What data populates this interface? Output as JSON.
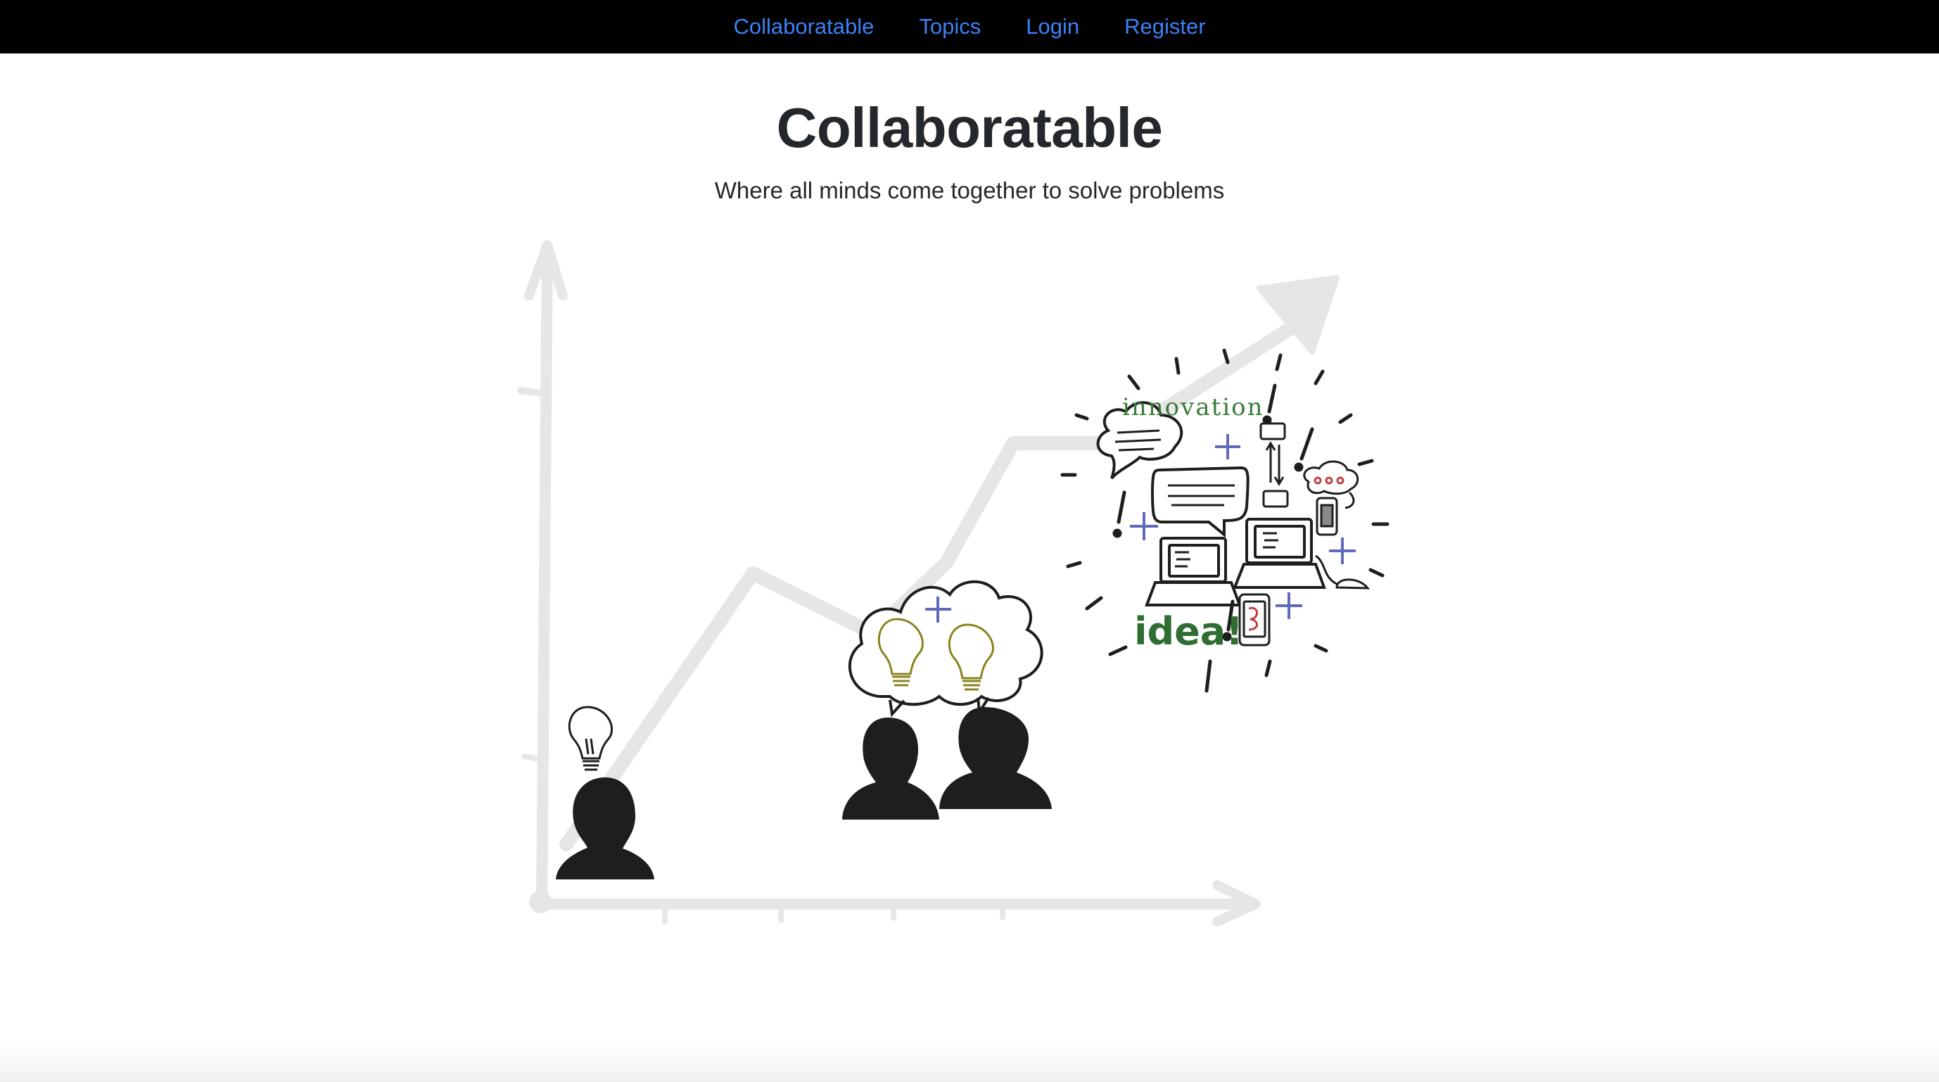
{
  "navbar": {
    "links": [
      {
        "label": "Collaboratable",
        "color": "#3b82f6"
      },
      {
        "label": "Topics",
        "color": "#3b82f6"
      },
      {
        "label": "Login",
        "color": "#3b82f6"
      },
      {
        "label": "Register",
        "color": "#3b82f6"
      }
    ],
    "background": "#000000"
  },
  "hero": {
    "title": "Collaboratable",
    "subtitle": "Where all minds come together to solve problems"
  },
  "illustration": {
    "innovation_text": "innovation",
    "idea_text": "idea!",
    "icons": [
      "growth-chart-icon",
      "lightbulb-icon",
      "person-silhouette-icon",
      "thought-cloud-icon",
      "laptop-icon",
      "speech-bubble-icon",
      "phone-icon"
    ]
  }
}
